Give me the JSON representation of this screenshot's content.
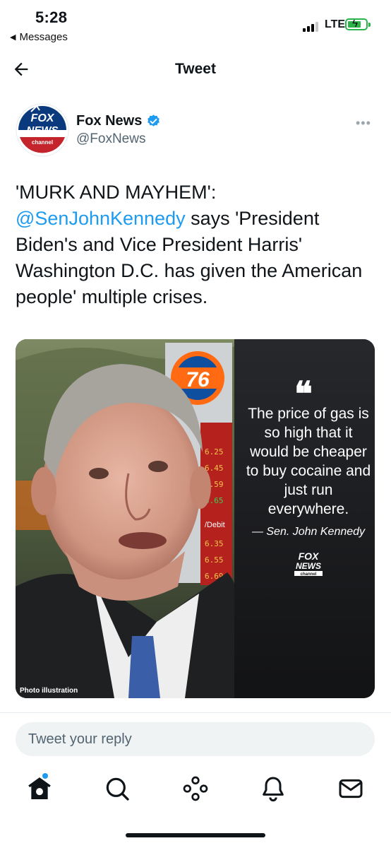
{
  "status_bar": {
    "time": "5:28",
    "back_app": "Messages",
    "network": "LTE"
  },
  "header": {
    "title": "Tweet"
  },
  "author": {
    "name": "Fox News",
    "handle": "@FoxNews",
    "verified": true,
    "avatar_icon": "fox-news-channel-logo"
  },
  "tweet": {
    "text_before": "'MURK AND MAYHEM': ",
    "mention": "@SenJohnKennedy",
    "text_after": " says 'President Biden's and Vice President Harris' Washington D.C. has given the American people' multiple crises."
  },
  "media": {
    "quote": "The price of gas is so high that it would be cheaper to buy cocaine and just run everywhere.",
    "attribution": "— Sen. John Kennedy",
    "caption": "Photo illustration",
    "gas_sign_brand": "76",
    "gas_prices": [
      "6.25",
      "6.45",
      "6.59",
      "6.65",
      "6.35",
      "6.55",
      "6.69"
    ],
    "gas_sign_label": "/Debit"
  },
  "reply": {
    "placeholder": "Tweet your reply"
  },
  "nav": [
    "home-icon",
    "search-icon",
    "spaces-icon",
    "notifications-icon",
    "messages-icon"
  ],
  "colors": {
    "accent": "#1d9bf0",
    "text": "#0f1419",
    "secondary": "#536471"
  }
}
